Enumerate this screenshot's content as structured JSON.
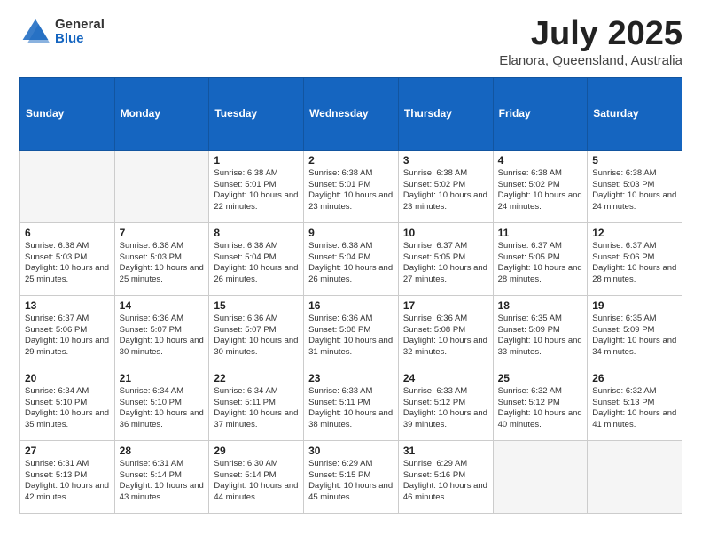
{
  "header": {
    "logo_general": "General",
    "logo_blue": "Blue",
    "month_year": "July 2025",
    "location": "Elanora, Queensland, Australia"
  },
  "weekdays": [
    "Sunday",
    "Monday",
    "Tuesday",
    "Wednesday",
    "Thursday",
    "Friday",
    "Saturday"
  ],
  "weeks": [
    [
      {
        "day": "",
        "sunrise": "",
        "sunset": "",
        "daylight": "",
        "empty": true
      },
      {
        "day": "",
        "sunrise": "",
        "sunset": "",
        "daylight": "",
        "empty": true
      },
      {
        "day": "1",
        "sunrise": "Sunrise: 6:38 AM",
        "sunset": "Sunset: 5:01 PM",
        "daylight": "Daylight: 10 hours and 22 minutes."
      },
      {
        "day": "2",
        "sunrise": "Sunrise: 6:38 AM",
        "sunset": "Sunset: 5:01 PM",
        "daylight": "Daylight: 10 hours and 23 minutes."
      },
      {
        "day": "3",
        "sunrise": "Sunrise: 6:38 AM",
        "sunset": "Sunset: 5:02 PM",
        "daylight": "Daylight: 10 hours and 23 minutes."
      },
      {
        "day": "4",
        "sunrise": "Sunrise: 6:38 AM",
        "sunset": "Sunset: 5:02 PM",
        "daylight": "Daylight: 10 hours and 24 minutes."
      },
      {
        "day": "5",
        "sunrise": "Sunrise: 6:38 AM",
        "sunset": "Sunset: 5:03 PM",
        "daylight": "Daylight: 10 hours and 24 minutes."
      }
    ],
    [
      {
        "day": "6",
        "sunrise": "Sunrise: 6:38 AM",
        "sunset": "Sunset: 5:03 PM",
        "daylight": "Daylight: 10 hours and 25 minutes."
      },
      {
        "day": "7",
        "sunrise": "Sunrise: 6:38 AM",
        "sunset": "Sunset: 5:03 PM",
        "daylight": "Daylight: 10 hours and 25 minutes."
      },
      {
        "day": "8",
        "sunrise": "Sunrise: 6:38 AM",
        "sunset": "Sunset: 5:04 PM",
        "daylight": "Daylight: 10 hours and 26 minutes."
      },
      {
        "day": "9",
        "sunrise": "Sunrise: 6:38 AM",
        "sunset": "Sunset: 5:04 PM",
        "daylight": "Daylight: 10 hours and 26 minutes."
      },
      {
        "day": "10",
        "sunrise": "Sunrise: 6:37 AM",
        "sunset": "Sunset: 5:05 PM",
        "daylight": "Daylight: 10 hours and 27 minutes."
      },
      {
        "day": "11",
        "sunrise": "Sunrise: 6:37 AM",
        "sunset": "Sunset: 5:05 PM",
        "daylight": "Daylight: 10 hours and 28 minutes."
      },
      {
        "day": "12",
        "sunrise": "Sunrise: 6:37 AM",
        "sunset": "Sunset: 5:06 PM",
        "daylight": "Daylight: 10 hours and 28 minutes."
      }
    ],
    [
      {
        "day": "13",
        "sunrise": "Sunrise: 6:37 AM",
        "sunset": "Sunset: 5:06 PM",
        "daylight": "Daylight: 10 hours and 29 minutes."
      },
      {
        "day": "14",
        "sunrise": "Sunrise: 6:36 AM",
        "sunset": "Sunset: 5:07 PM",
        "daylight": "Daylight: 10 hours and 30 minutes."
      },
      {
        "day": "15",
        "sunrise": "Sunrise: 6:36 AM",
        "sunset": "Sunset: 5:07 PM",
        "daylight": "Daylight: 10 hours and 30 minutes."
      },
      {
        "day": "16",
        "sunrise": "Sunrise: 6:36 AM",
        "sunset": "Sunset: 5:08 PM",
        "daylight": "Daylight: 10 hours and 31 minutes."
      },
      {
        "day": "17",
        "sunrise": "Sunrise: 6:36 AM",
        "sunset": "Sunset: 5:08 PM",
        "daylight": "Daylight: 10 hours and 32 minutes."
      },
      {
        "day": "18",
        "sunrise": "Sunrise: 6:35 AM",
        "sunset": "Sunset: 5:09 PM",
        "daylight": "Daylight: 10 hours and 33 minutes."
      },
      {
        "day": "19",
        "sunrise": "Sunrise: 6:35 AM",
        "sunset": "Sunset: 5:09 PM",
        "daylight": "Daylight: 10 hours and 34 minutes."
      }
    ],
    [
      {
        "day": "20",
        "sunrise": "Sunrise: 6:34 AM",
        "sunset": "Sunset: 5:10 PM",
        "daylight": "Daylight: 10 hours and 35 minutes."
      },
      {
        "day": "21",
        "sunrise": "Sunrise: 6:34 AM",
        "sunset": "Sunset: 5:10 PM",
        "daylight": "Daylight: 10 hours and 36 minutes."
      },
      {
        "day": "22",
        "sunrise": "Sunrise: 6:34 AM",
        "sunset": "Sunset: 5:11 PM",
        "daylight": "Daylight: 10 hours and 37 minutes."
      },
      {
        "day": "23",
        "sunrise": "Sunrise: 6:33 AM",
        "sunset": "Sunset: 5:11 PM",
        "daylight": "Daylight: 10 hours and 38 minutes."
      },
      {
        "day": "24",
        "sunrise": "Sunrise: 6:33 AM",
        "sunset": "Sunset: 5:12 PM",
        "daylight": "Daylight: 10 hours and 39 minutes."
      },
      {
        "day": "25",
        "sunrise": "Sunrise: 6:32 AM",
        "sunset": "Sunset: 5:12 PM",
        "daylight": "Daylight: 10 hours and 40 minutes."
      },
      {
        "day": "26",
        "sunrise": "Sunrise: 6:32 AM",
        "sunset": "Sunset: 5:13 PM",
        "daylight": "Daylight: 10 hours and 41 minutes."
      }
    ],
    [
      {
        "day": "27",
        "sunrise": "Sunrise: 6:31 AM",
        "sunset": "Sunset: 5:13 PM",
        "daylight": "Daylight: 10 hours and 42 minutes."
      },
      {
        "day": "28",
        "sunrise": "Sunrise: 6:31 AM",
        "sunset": "Sunset: 5:14 PM",
        "daylight": "Daylight: 10 hours and 43 minutes."
      },
      {
        "day": "29",
        "sunrise": "Sunrise: 6:30 AM",
        "sunset": "Sunset: 5:14 PM",
        "daylight": "Daylight: 10 hours and 44 minutes."
      },
      {
        "day": "30",
        "sunrise": "Sunrise: 6:29 AM",
        "sunset": "Sunset: 5:15 PM",
        "daylight": "Daylight: 10 hours and 45 minutes."
      },
      {
        "day": "31",
        "sunrise": "Sunrise: 6:29 AM",
        "sunset": "Sunset: 5:16 PM",
        "daylight": "Daylight: 10 hours and 46 minutes."
      },
      {
        "day": "",
        "sunrise": "",
        "sunset": "",
        "daylight": "",
        "empty": true
      },
      {
        "day": "",
        "sunrise": "",
        "sunset": "",
        "daylight": "",
        "empty": true
      }
    ]
  ]
}
